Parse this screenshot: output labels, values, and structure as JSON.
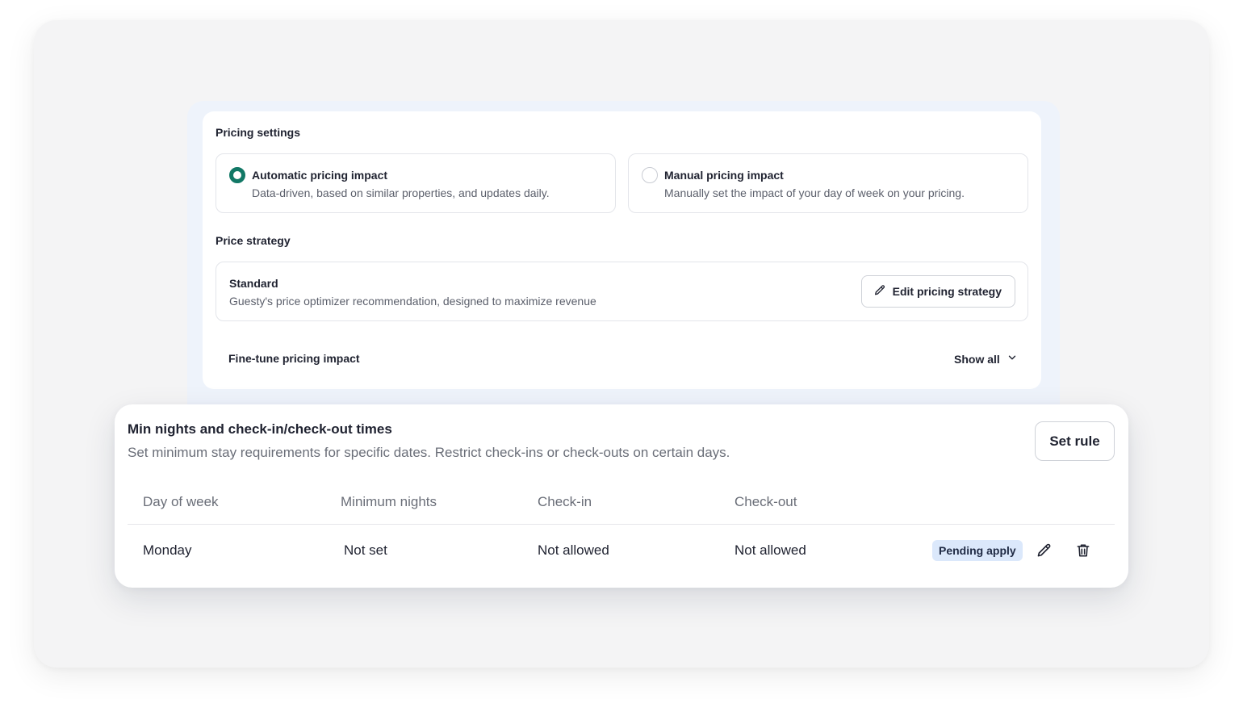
{
  "pricing": {
    "settings_label": "Pricing settings",
    "options": [
      {
        "title": "Automatic pricing impact",
        "description": "Data-driven, based on similar properties, and updates daily.",
        "selected": true
      },
      {
        "title": "Manual pricing impact",
        "description": "Manually set the impact of your day of week on your pricing.",
        "selected": false
      }
    ],
    "strategy_label": "Price strategy",
    "strategy": {
      "name": "Standard",
      "description": "Guesty's price optimizer recommendation, designed to maximize revenue",
      "edit_label": "Edit pricing strategy"
    },
    "finetune_label": "Fine-tune pricing impact",
    "show_all_label": "Show all"
  },
  "rules": {
    "title": "Min nights and check-in/check-out times",
    "description": "Set minimum stay requirements for specific dates. Restrict check-ins or check-outs on certain days.",
    "set_rule_label": "Set rule",
    "columns": [
      "Day of week",
      "Minimum nights",
      "Check-in",
      "Check-out"
    ],
    "rows": [
      {
        "day": "Monday",
        "min_nights": "Not set",
        "check_in": "Not allowed",
        "check_out": "Not allowed",
        "status": "Pending apply"
      }
    ]
  },
  "colors": {
    "accent": "#127866",
    "badge_bg": "#dbe8fb",
    "panel_bg": "#eef3fb"
  },
  "icons": [
    "pencil-icon",
    "chevron-down-icon",
    "edit-icon",
    "trash-icon"
  ]
}
